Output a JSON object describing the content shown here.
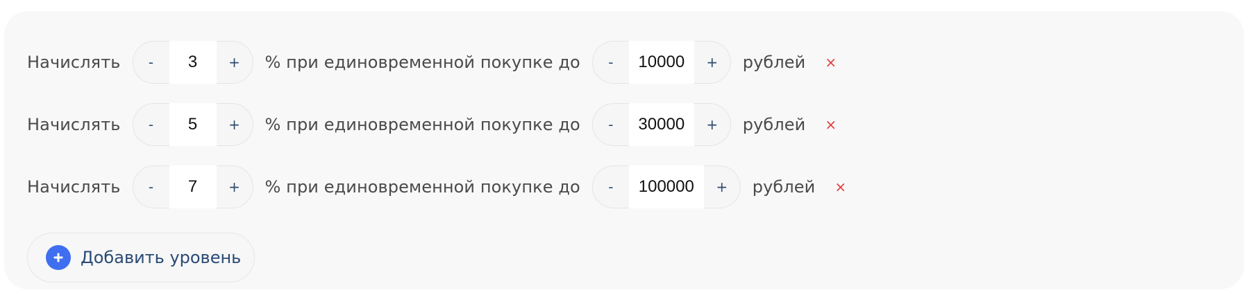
{
  "tiers": [
    {
      "prefix_label": "Начислять",
      "percent": {
        "decrement_label": "-",
        "value": "3",
        "increment_label": "+"
      },
      "middle_label": "% при единовременной покупке до",
      "amount": {
        "decrement_label": "-",
        "value": "10000",
        "increment_label": "+"
      },
      "suffix_label": "рублей",
      "remove_label": "×"
    },
    {
      "prefix_label": "Начислять",
      "percent": {
        "decrement_label": "-",
        "value": "5",
        "increment_label": "+"
      },
      "middle_label": "% при единовременной покупке до",
      "amount": {
        "decrement_label": "-",
        "value": "30000",
        "increment_label": "+"
      },
      "suffix_label": "рублей",
      "remove_label": "×"
    },
    {
      "prefix_label": "Начислять",
      "percent": {
        "decrement_label": "-",
        "value": "7",
        "increment_label": "+"
      },
      "middle_label": "% при единовременной покупке до",
      "amount": {
        "decrement_label": "-",
        "value": "100000",
        "increment_label": "+"
      },
      "suffix_label": "рублей",
      "remove_label": "×"
    }
  ],
  "add_level": {
    "label": "Добавить уровень",
    "icon": "plus-circle-icon"
  },
  "colors": {
    "panel_background": "#f8f8f9",
    "accent": "#3f6ef0",
    "remove": "#e23b3b",
    "text": "#4a4a4a",
    "button_text": "#2a4a73"
  }
}
